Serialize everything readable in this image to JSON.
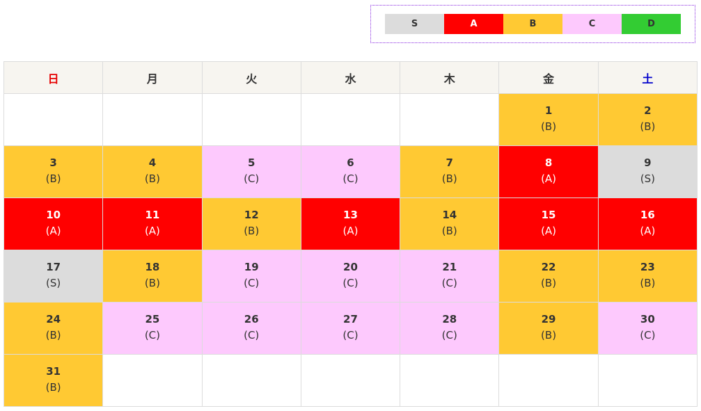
{
  "legend": [
    {
      "label": "S",
      "color": "#dcdcdc"
    },
    {
      "label": "A",
      "color": "#ff0000"
    },
    {
      "label": "B",
      "color": "#ffc933"
    },
    {
      "label": "C",
      "color": "#fdc9fd"
    },
    {
      "label": "D",
      "color": "#33cc33"
    }
  ],
  "grade_colors": {
    "S": "#dcdcdc",
    "A": "#ff0000",
    "B": "#ffc933",
    "C": "#fdc9fd"
  },
  "weekdays": [
    "日",
    "月",
    "火",
    "水",
    "木",
    "金",
    "土"
  ],
  "weeks": [
    [
      null,
      null,
      null,
      null,
      null,
      {
        "day": "1",
        "grade": "(B)"
      },
      {
        "day": "2",
        "grade": "(B)"
      }
    ],
    [
      {
        "day": "3",
        "grade": "(B)"
      },
      {
        "day": "4",
        "grade": "(B)"
      },
      {
        "day": "5",
        "grade": "(C)"
      },
      {
        "day": "6",
        "grade": "(C)"
      },
      {
        "day": "7",
        "grade": "(B)"
      },
      {
        "day": "8",
        "grade": "(A)"
      },
      {
        "day": "9",
        "grade": "(S)"
      }
    ],
    [
      {
        "day": "10",
        "grade": "(A)"
      },
      {
        "day": "11",
        "grade": "(A)"
      },
      {
        "day": "12",
        "grade": "(B)"
      },
      {
        "day": "13",
        "grade": "(A)"
      },
      {
        "day": "14",
        "grade": "(B)"
      },
      {
        "day": "15",
        "grade": "(A)"
      },
      {
        "day": "16",
        "grade": "(A)"
      }
    ],
    [
      {
        "day": "17",
        "grade": "(S)"
      },
      {
        "day": "18",
        "grade": "(B)"
      },
      {
        "day": "19",
        "grade": "(C)"
      },
      {
        "day": "20",
        "grade": "(C)"
      },
      {
        "day": "21",
        "grade": "(C)"
      },
      {
        "day": "22",
        "grade": "(B)"
      },
      {
        "day": "23",
        "grade": "(B)"
      }
    ],
    [
      {
        "day": "24",
        "grade": "(B)"
      },
      {
        "day": "25",
        "grade": "(C)"
      },
      {
        "day": "26",
        "grade": "(C)"
      },
      {
        "day": "27",
        "grade": "(C)"
      },
      {
        "day": "28",
        "grade": "(C)"
      },
      {
        "day": "29",
        "grade": "(B)"
      },
      {
        "day": "30",
        "grade": "(C)"
      }
    ],
    [
      {
        "day": "31",
        "grade": "(B)"
      },
      null,
      null,
      null,
      null,
      null,
      null
    ]
  ]
}
